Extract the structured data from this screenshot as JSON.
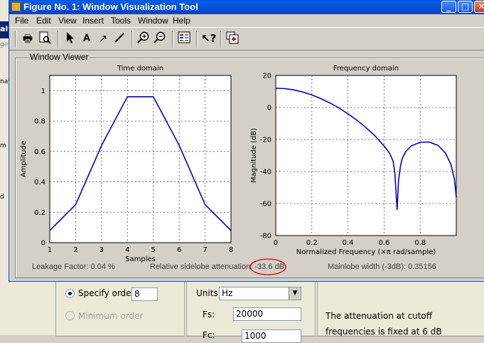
{
  "window": {
    "title": "Figure No. 1: Window Visualization Tool",
    "menus": [
      "File",
      "Edit",
      "View",
      "Insert",
      "Tools",
      "Window",
      "Help"
    ],
    "toolbar_icons": [
      "print-icon",
      "print-preview-icon",
      "pointer-icon",
      "text-icon",
      "arrow-icon",
      "line-icon",
      "zoom-in-icon",
      "zoom-out-icon",
      "legend-icon",
      "whats-this-icon",
      "new-window-icon"
    ]
  },
  "viewer": {
    "title": "Window Viewer",
    "leakage": "Leakage Factor: 0.04 %",
    "sidelobe": "Relative sidelobe attenuation: -33.6 dB",
    "mainlobe": "Mainlobe width (-3dB): 0.35156"
  },
  "chart_data": [
    {
      "type": "line",
      "title": "Time domain",
      "xlabel": "Samples",
      "ylabel": "Amplitude",
      "xlim": [
        1,
        8
      ],
      "ylim": [
        0,
        1.1
      ],
      "xticks": [
        "1",
        "2",
        "3",
        "4",
        "5",
        "6",
        "7",
        "8"
      ],
      "yticks": [
        "0",
        "0.2",
        "0.4",
        "0.6",
        "0.8",
        "1"
      ],
      "grid": true,
      "series": [
        {
          "color": "#0000cc",
          "x": [
            1,
            2,
            3,
            4,
            5,
            6,
            7,
            8
          ],
          "y": [
            0.08,
            0.25,
            0.64,
            0.96,
            0.96,
            0.64,
            0.25,
            0.08
          ]
        }
      ]
    },
    {
      "type": "line",
      "title": "Frequency domain",
      "xlabel": "Normalized Frequency  (×π rad/sample)",
      "ylabel": "Magnitude (dB)",
      "xlim": [
        0,
        1
      ],
      "ylim": [
        -80,
        20
      ],
      "xticks": [
        "0",
        "0.2",
        "0.4",
        "0.6",
        "0.8"
      ],
      "yticks": [
        "-80",
        "-60",
        "-40",
        "-20",
        "0",
        "20"
      ],
      "grid": true,
      "series": [
        {
          "color": "#0000cc",
          "x": [
            0,
            0.05,
            0.1,
            0.15,
            0.2,
            0.25,
            0.3,
            0.35,
            0.4,
            0.45,
            0.5,
            0.55,
            0.6,
            0.63,
            0.65,
            0.66,
            0.672,
            0.68,
            0.69,
            0.7,
            0.72,
            0.75,
            0.8,
            0.85,
            0.9,
            0.94,
            0.97,
            0.99,
            1.0
          ],
          "y": [
            12.0,
            11.8,
            11.0,
            9.6,
            7.8,
            5.5,
            2.8,
            -0.3,
            -4.0,
            -8.0,
            -12.6,
            -17.8,
            -24.0,
            -28.5,
            -33.5,
            -41.0,
            -64.0,
            -46.0,
            -37.0,
            -32.0,
            -27.5,
            -24.0,
            -21.8,
            -21.6,
            -23.8,
            -28.5,
            -35.5,
            -45.0,
            -56.0
          ]
        }
      ]
    }
  ],
  "background": {
    "specify_order_label": "Specify order:",
    "order_value": "8",
    "minimum_order_label": "Minimum order",
    "units_label": "Units:",
    "units_value": "Hz",
    "fs_label": "Fs:",
    "fs_value": "20000",
    "fc_label": "Fc:",
    "fc_value": "1000",
    "note_line1": "The attenuation at cutoff",
    "note_line2": "frequencies is fixed at 6 dB",
    "left_fragments": [
      "aly",
      "get",
      "nati",
      "m F",
      "d"
    ]
  }
}
